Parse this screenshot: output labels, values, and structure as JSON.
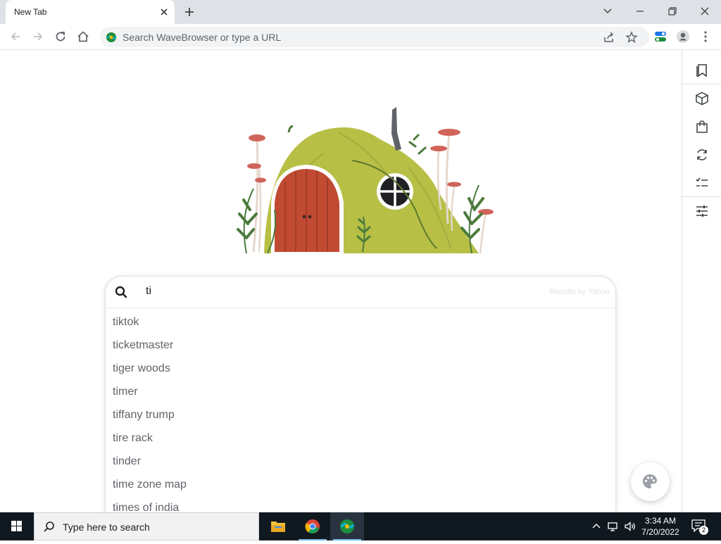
{
  "window": {
    "tab_title": "New Tab",
    "controls": [
      "chevron-down",
      "minimize",
      "restore",
      "close"
    ]
  },
  "toolbar": {
    "omnibox_placeholder": "Search WaveBrowser or type a URL"
  },
  "side_panel": {
    "icons": [
      "bookmark-icon",
      "box-icon",
      "shopping-bag-icon",
      "sync-icon",
      "checklist-icon",
      "sliders-icon"
    ]
  },
  "search": {
    "query": "ti",
    "results_by": "Results by Yahoo",
    "suggestions": [
      "tiktok",
      "ticketmaster",
      "tiger woods",
      "timer",
      "tiffany trump",
      "tire rack",
      "tinder",
      "time zone map",
      "times of india"
    ]
  },
  "taskbar": {
    "search_placeholder": "Type here to search",
    "time": "3:34 AM",
    "date": "7/20/2022",
    "notification_count": "2"
  },
  "colors": {
    "tabstrip": "#dee1e6",
    "taskbar": "#101820",
    "door": "#c14a33",
    "hill": "#b7bf45"
  }
}
